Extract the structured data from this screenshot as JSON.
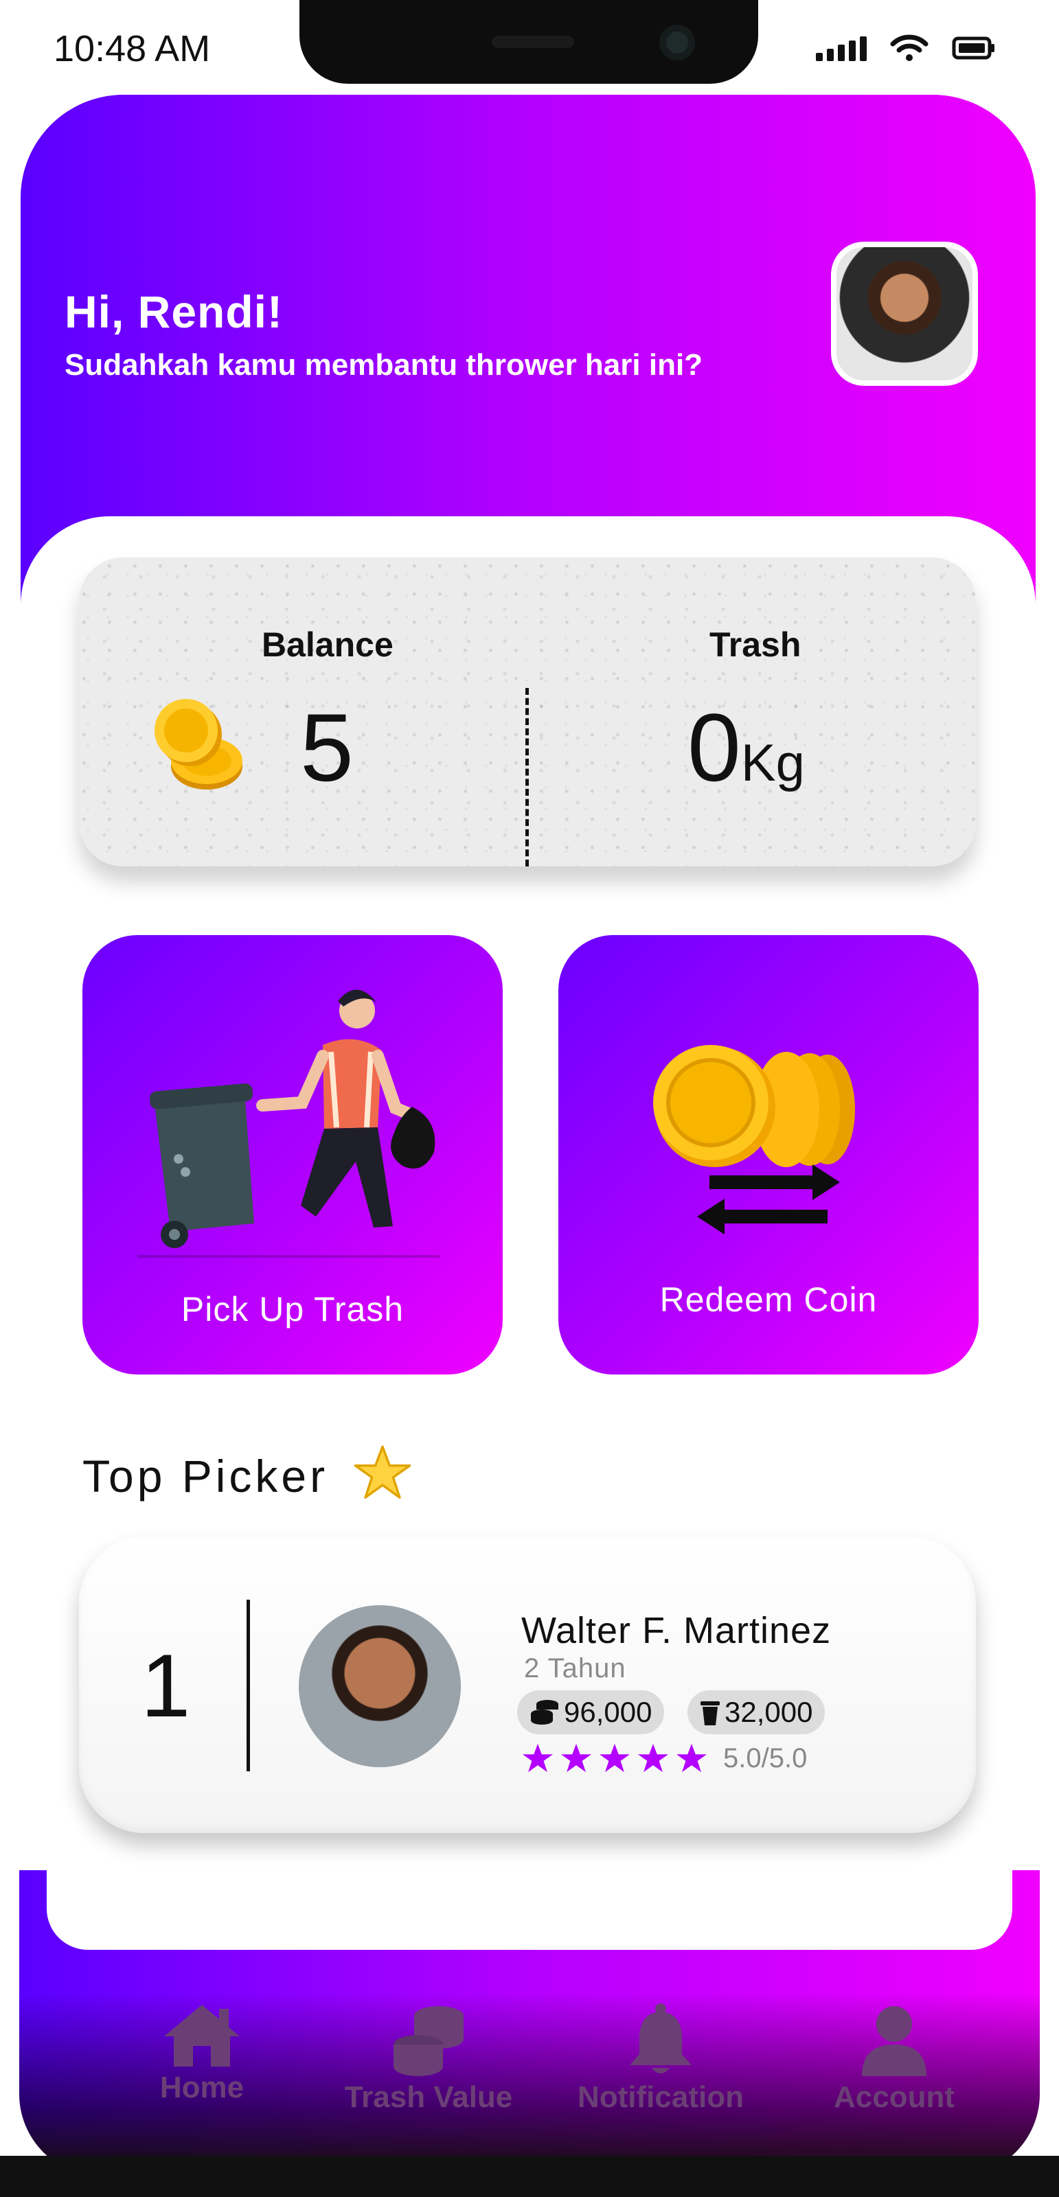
{
  "status_bar": {
    "time": "10:48 AM"
  },
  "header": {
    "greeting": "Hi, Rendi!",
    "subtitle": "Sudahkah kamu membantu thrower hari ini?"
  },
  "summary": {
    "balance_label": "Balance",
    "balance_value": "5",
    "trash_label": "Trash",
    "trash_value": "0",
    "trash_unit": "Kg"
  },
  "actions": [
    {
      "label": "Pick Up Trash"
    },
    {
      "label": "Redeem Coin"
    }
  ],
  "top_picker": {
    "title": "Top Picker",
    "entries": [
      {
        "rank": "1",
        "name": "Walter F. Martinez",
        "years": "2 Tahun",
        "coins": "96,000",
        "trash": "32,000",
        "rating_text": "5.0/5.0",
        "stars": 5
      }
    ]
  },
  "nav": {
    "items": [
      {
        "label": "Home",
        "icon": "home-icon"
      },
      {
        "label": "Trash Value",
        "icon": "coins-stack-icon"
      },
      {
        "label": "Notification",
        "icon": "bell-icon"
      },
      {
        "label": "Account",
        "icon": "user-icon"
      }
    ]
  },
  "colors": {
    "gradient_start": "#5a00ff",
    "gradient_end": "#f000ff",
    "coin_gold": "#f7b500",
    "star_purple": "#b400ff"
  }
}
